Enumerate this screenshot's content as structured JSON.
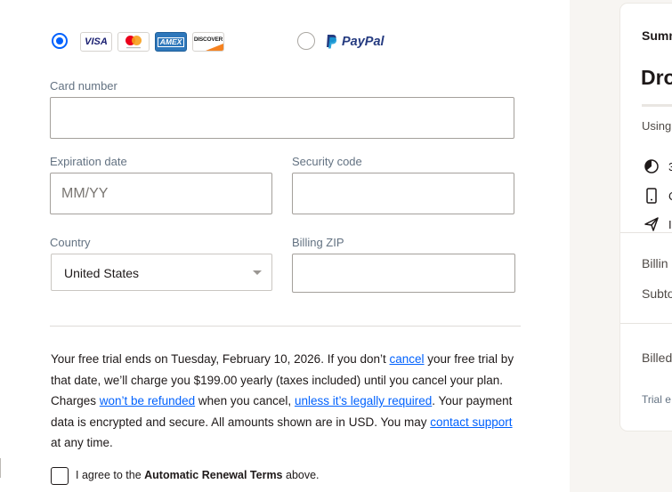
{
  "payment_methods": {
    "card_logos": [
      {
        "name": "visa",
        "label": "VISA",
        "color": "#1a1f71"
      },
      {
        "name": "mastercard",
        "label": "",
        "color": "#eb001b"
      },
      {
        "name": "amex",
        "label": "AMEX",
        "color": "#2e77bb"
      },
      {
        "name": "discover",
        "label": "DISCOVER",
        "color": "#f58220"
      }
    ],
    "paypal_label": "PayPal"
  },
  "form": {
    "card_number_label": "Card number",
    "expiration_label": "Expiration date",
    "expiration_placeholder": "MM/YY",
    "security_label": "Security code",
    "country_label": "Country",
    "country_value": "United States",
    "zip_label": "Billing ZIP"
  },
  "terms": {
    "t1": "Your free trial ends on Tuesday, February 10, 2026. If you don’t ",
    "link_cancel": "cancel",
    "t2": " your free trial by that date, we’ll charge you $199.00 yearly (taxes included) until you cancel your plan. Charges ",
    "link_refund": "won’t be refunded",
    "t3": " when you cancel, ",
    "link_legal": "unless it’s legally required",
    "t4": ". Your payment data is encrypted and secure. All amounts shown are in USD. You may ",
    "link_support": "contact support",
    "t5": " at any time.",
    "agree_prefix": "I agree to the ",
    "agree_bold": "Automatic Renewal Terms",
    "agree_suffix": " above."
  },
  "summary": {
    "title": "Summ",
    "product": "Dro",
    "using": "Using",
    "feature1": "3",
    "feature2": "C",
    "feature3": "I",
    "billing": "Billin",
    "subtotal": "Subto",
    "billed": "Billed",
    "trial": "Trial e"
  },
  "colors": {
    "accent": "#0061fe",
    "paypal_dark": "#253b80",
    "paypal_light": "#179bd7"
  }
}
